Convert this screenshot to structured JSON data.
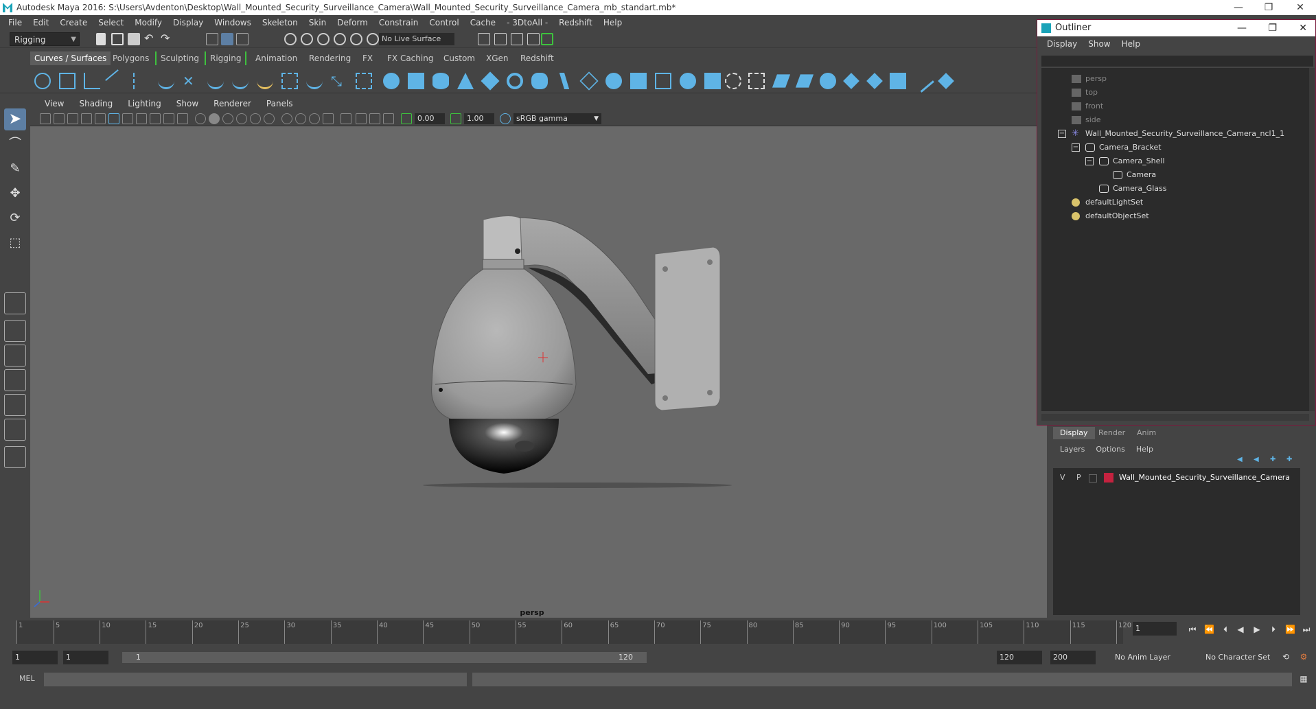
{
  "window": {
    "title": "Autodesk Maya 2016: S:\\Users\\Avdenton\\Desktop\\Wall_Mounted_Security_Surveillance_Camera\\Wall_Mounted_Security_Surveillance_Camera_mb_standart.mb*",
    "minimize": "—",
    "maximize": "❐",
    "close": "✕"
  },
  "menubar": [
    "File",
    "Edit",
    "Create",
    "Select",
    "Modify",
    "Display",
    "Windows",
    "Skeleton",
    "Skin",
    "Deform",
    "Constrain",
    "Control",
    "Cache",
    "- 3DtoAll -",
    "Redshift",
    "Help"
  ],
  "statusline": {
    "mode": "Rigging",
    "live_surface": "No Live Surface"
  },
  "shelf_tabs": [
    "Curves / Surfaces",
    "Polygons",
    "Sculpting",
    "Rigging",
    "Animation",
    "Rendering",
    "FX",
    "FX Caching",
    "Custom",
    "XGen",
    "Redshift"
  ],
  "viewport": {
    "menu": [
      "View",
      "Shading",
      "Lighting",
      "Show",
      "Renderer",
      "Panels"
    ],
    "exposure": "0.00",
    "gamma": "1.00",
    "color_space": "sRGB gamma",
    "camera_label": "persp"
  },
  "outliner": {
    "title": "Outliner",
    "menu": [
      "Display",
      "Show",
      "Help"
    ],
    "items": [
      {
        "label": "persp",
        "type": "camera",
        "dim": true
      },
      {
        "label": "top",
        "type": "camera",
        "dim": true
      },
      {
        "label": "front",
        "type": "camera",
        "dim": true
      },
      {
        "label": "side",
        "type": "camera",
        "dim": true
      },
      {
        "label": "Wall_Mounted_Security_Surveillance_Camera_ncl1_1",
        "type": "group"
      },
      {
        "label": "Camera_Bracket",
        "type": "mesh"
      },
      {
        "label": "Camera_Shell",
        "type": "mesh"
      },
      {
        "label": "Camera",
        "type": "mesh"
      },
      {
        "label": "Camera_Glass",
        "type": "mesh"
      },
      {
        "label": "defaultLightSet",
        "type": "set"
      },
      {
        "label": "defaultObjectSet",
        "type": "set"
      }
    ]
  },
  "layers": {
    "tabs": [
      "Display",
      "Render",
      "Anim"
    ],
    "menu": [
      "Layers",
      "Options",
      "Help"
    ],
    "row": {
      "v": "V",
      "p": "P",
      "name": "Wall_Mounted_Security_Surveillance_Camera",
      "color": "#c4223f"
    }
  },
  "timeline": {
    "ticks": [
      "1",
      "5",
      "10",
      "15",
      "20",
      "25",
      "30",
      "35",
      "40",
      "45",
      "50",
      "55",
      "60",
      "65",
      "70",
      "75",
      "80",
      "85",
      "90",
      "95",
      "100",
      "105",
      "110",
      "115",
      "120"
    ],
    "current_frame": "1"
  },
  "range": {
    "start": "1",
    "playback_start": "1",
    "slider_start": "1",
    "slider_end": "120",
    "playback_end": "120",
    "end": "200",
    "anim_layer": "No Anim Layer",
    "character_set": "No Character Set"
  },
  "cmdline": {
    "lang": "MEL"
  }
}
